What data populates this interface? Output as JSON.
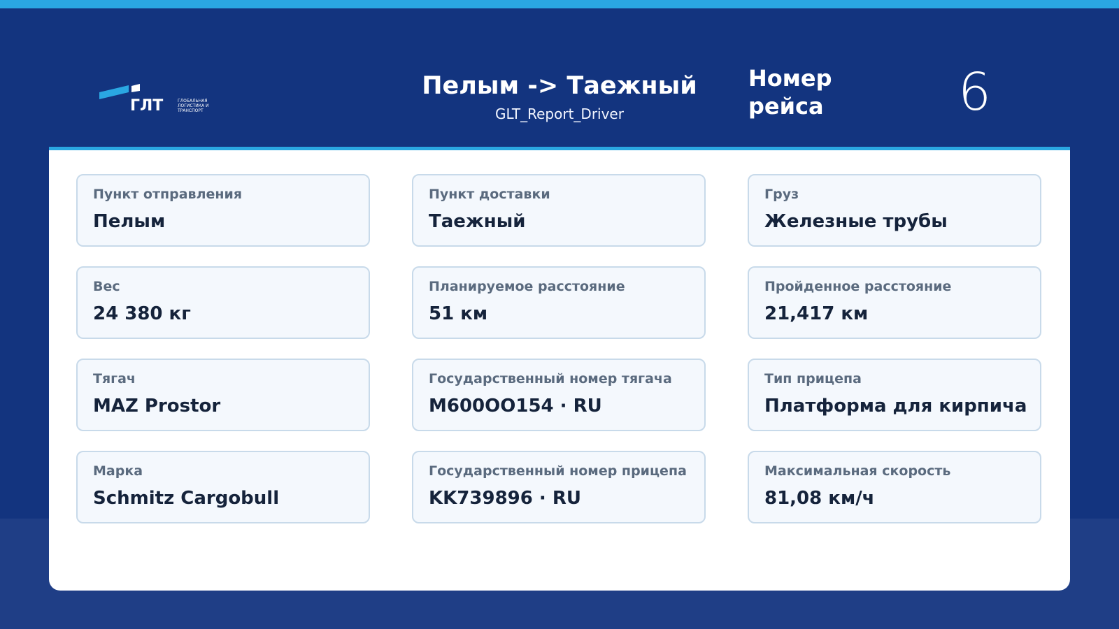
{
  "colors": {
    "top_stripe": "#2aa7e2",
    "header_bg": "#13347f",
    "page_bg": "#1f3e86",
    "card_bg": "#f4f8fd",
    "card_border": "#c8daea",
    "label_text": "#5a6a7e",
    "value_text": "#15233b"
  },
  "logo": {
    "text": "ГЛТ",
    "tagline": "ГЛОБАЛЬНАЯ ЛОГИСТИКА И ТРАНСПОРТ"
  },
  "header": {
    "route": "Пелым -> Таежный",
    "report_name": "GLT_Report_Driver",
    "trip_label": "Номер рейса",
    "trip_number": "6"
  },
  "cards": [
    {
      "label": "Пункт отправления",
      "value": "Пелым"
    },
    {
      "label": "Пункт доставки",
      "value": "Таежный"
    },
    {
      "label": "Груз",
      "value": "Железные трубы"
    },
    {
      "label": "Вес",
      "value": "24 380 кг"
    },
    {
      "label": "Планируемое расстояние",
      "value": "51 км"
    },
    {
      "label": "Пройденное расстояние",
      "value": "21,417 км"
    },
    {
      "label": "Тягач",
      "value": "MAZ Prostor"
    },
    {
      "label": "Государственный номер тягача",
      "value": "M600OO154 · RU"
    },
    {
      "label": "Тип прицепа",
      "value": "Платформа для кирпича"
    },
    {
      "label": "Марка",
      "value": "Schmitz Cargobull"
    },
    {
      "label": "Государственный номер прицепа",
      "value": "KK739896 · RU"
    },
    {
      "label": "Максимальная скорость",
      "value": "81,08 км/ч"
    }
  ]
}
